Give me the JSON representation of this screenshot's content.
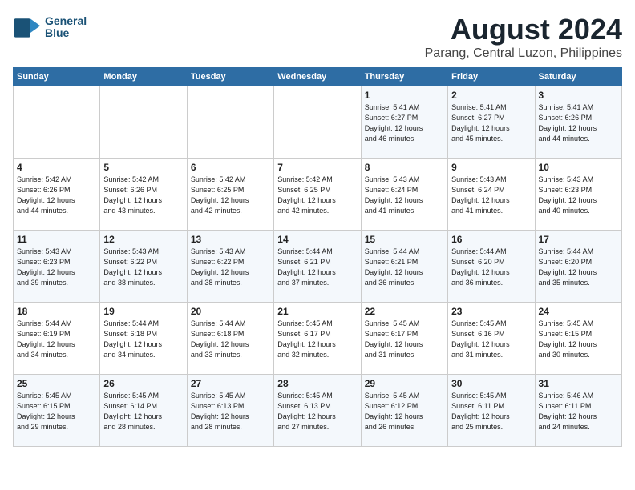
{
  "header": {
    "logo_line1": "General",
    "logo_line2": "Blue",
    "month_year": "August 2024",
    "location": "Parang, Central Luzon, Philippines"
  },
  "days_of_week": [
    "Sunday",
    "Monday",
    "Tuesday",
    "Wednesday",
    "Thursday",
    "Friday",
    "Saturday"
  ],
  "weeks": [
    [
      {
        "day": "",
        "text": ""
      },
      {
        "day": "",
        "text": ""
      },
      {
        "day": "",
        "text": ""
      },
      {
        "day": "",
        "text": ""
      },
      {
        "day": "1",
        "text": "Sunrise: 5:41 AM\nSunset: 6:27 PM\nDaylight: 12 hours\nand 46 minutes."
      },
      {
        "day": "2",
        "text": "Sunrise: 5:41 AM\nSunset: 6:27 PM\nDaylight: 12 hours\nand 45 minutes."
      },
      {
        "day": "3",
        "text": "Sunrise: 5:41 AM\nSunset: 6:26 PM\nDaylight: 12 hours\nand 44 minutes."
      }
    ],
    [
      {
        "day": "4",
        "text": "Sunrise: 5:42 AM\nSunset: 6:26 PM\nDaylight: 12 hours\nand 44 minutes."
      },
      {
        "day": "5",
        "text": "Sunrise: 5:42 AM\nSunset: 6:26 PM\nDaylight: 12 hours\nand 43 minutes."
      },
      {
        "day": "6",
        "text": "Sunrise: 5:42 AM\nSunset: 6:25 PM\nDaylight: 12 hours\nand 42 minutes."
      },
      {
        "day": "7",
        "text": "Sunrise: 5:42 AM\nSunset: 6:25 PM\nDaylight: 12 hours\nand 42 minutes."
      },
      {
        "day": "8",
        "text": "Sunrise: 5:43 AM\nSunset: 6:24 PM\nDaylight: 12 hours\nand 41 minutes."
      },
      {
        "day": "9",
        "text": "Sunrise: 5:43 AM\nSunset: 6:24 PM\nDaylight: 12 hours\nand 41 minutes."
      },
      {
        "day": "10",
        "text": "Sunrise: 5:43 AM\nSunset: 6:23 PM\nDaylight: 12 hours\nand 40 minutes."
      }
    ],
    [
      {
        "day": "11",
        "text": "Sunrise: 5:43 AM\nSunset: 6:23 PM\nDaylight: 12 hours\nand 39 minutes."
      },
      {
        "day": "12",
        "text": "Sunrise: 5:43 AM\nSunset: 6:22 PM\nDaylight: 12 hours\nand 38 minutes."
      },
      {
        "day": "13",
        "text": "Sunrise: 5:43 AM\nSunset: 6:22 PM\nDaylight: 12 hours\nand 38 minutes."
      },
      {
        "day": "14",
        "text": "Sunrise: 5:44 AM\nSunset: 6:21 PM\nDaylight: 12 hours\nand 37 minutes."
      },
      {
        "day": "15",
        "text": "Sunrise: 5:44 AM\nSunset: 6:21 PM\nDaylight: 12 hours\nand 36 minutes."
      },
      {
        "day": "16",
        "text": "Sunrise: 5:44 AM\nSunset: 6:20 PM\nDaylight: 12 hours\nand 36 minutes."
      },
      {
        "day": "17",
        "text": "Sunrise: 5:44 AM\nSunset: 6:20 PM\nDaylight: 12 hours\nand 35 minutes."
      }
    ],
    [
      {
        "day": "18",
        "text": "Sunrise: 5:44 AM\nSunset: 6:19 PM\nDaylight: 12 hours\nand 34 minutes."
      },
      {
        "day": "19",
        "text": "Sunrise: 5:44 AM\nSunset: 6:18 PM\nDaylight: 12 hours\nand 34 minutes."
      },
      {
        "day": "20",
        "text": "Sunrise: 5:44 AM\nSunset: 6:18 PM\nDaylight: 12 hours\nand 33 minutes."
      },
      {
        "day": "21",
        "text": "Sunrise: 5:45 AM\nSunset: 6:17 PM\nDaylight: 12 hours\nand 32 minutes."
      },
      {
        "day": "22",
        "text": "Sunrise: 5:45 AM\nSunset: 6:17 PM\nDaylight: 12 hours\nand 31 minutes."
      },
      {
        "day": "23",
        "text": "Sunrise: 5:45 AM\nSunset: 6:16 PM\nDaylight: 12 hours\nand 31 minutes."
      },
      {
        "day": "24",
        "text": "Sunrise: 5:45 AM\nSunset: 6:15 PM\nDaylight: 12 hours\nand 30 minutes."
      }
    ],
    [
      {
        "day": "25",
        "text": "Sunrise: 5:45 AM\nSunset: 6:15 PM\nDaylight: 12 hours\nand 29 minutes."
      },
      {
        "day": "26",
        "text": "Sunrise: 5:45 AM\nSunset: 6:14 PM\nDaylight: 12 hours\nand 28 minutes."
      },
      {
        "day": "27",
        "text": "Sunrise: 5:45 AM\nSunset: 6:13 PM\nDaylight: 12 hours\nand 28 minutes."
      },
      {
        "day": "28",
        "text": "Sunrise: 5:45 AM\nSunset: 6:13 PM\nDaylight: 12 hours\nand 27 minutes."
      },
      {
        "day": "29",
        "text": "Sunrise: 5:45 AM\nSunset: 6:12 PM\nDaylight: 12 hours\nand 26 minutes."
      },
      {
        "day": "30",
        "text": "Sunrise: 5:45 AM\nSunset: 6:11 PM\nDaylight: 12 hours\nand 25 minutes."
      },
      {
        "day": "31",
        "text": "Sunrise: 5:46 AM\nSunset: 6:11 PM\nDaylight: 12 hours\nand 24 minutes."
      }
    ]
  ]
}
